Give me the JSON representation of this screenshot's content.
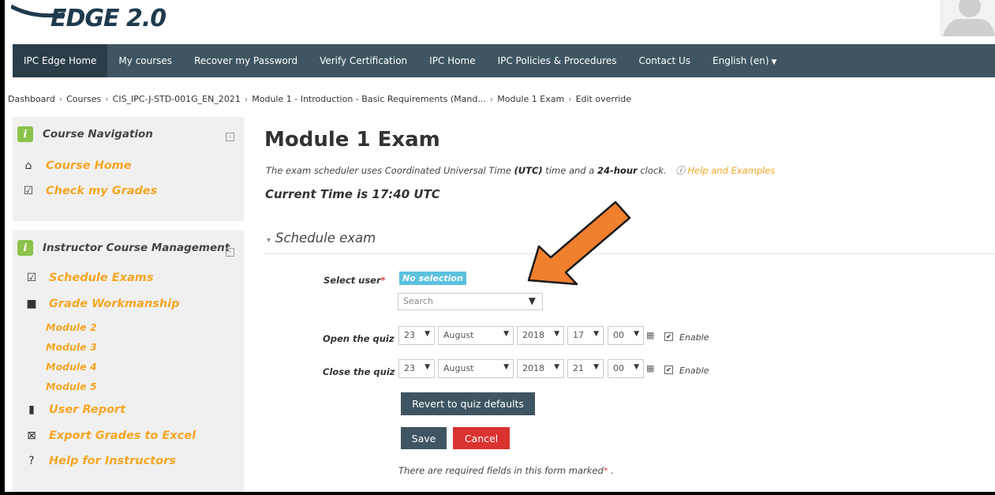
{
  "header": {
    "logo_text": "EDGE 2.0"
  },
  "navbar": {
    "items": [
      {
        "label": "IPC Edge Home"
      },
      {
        "label": "My courses"
      },
      {
        "label": "Recover my Password"
      },
      {
        "label": "Verify Certification"
      },
      {
        "label": "IPC Home"
      },
      {
        "label": "IPC Policies & Procedures"
      },
      {
        "label": "Contact Us"
      },
      {
        "label": "English (en)"
      }
    ]
  },
  "breadcrumb": [
    "Dashboard",
    "Courses",
    "CIS_IPC-J-STD-001G_EN_2021",
    "Module 1 - Introduction - Basic Requirements (Mand...",
    "Module 1 Exam",
    "Edit override"
  ],
  "sidebar": {
    "course_nav": {
      "title": "Course Navigation",
      "items": [
        {
          "label": "Course Home",
          "icon": "home-icon"
        },
        {
          "label": "Check my Grades",
          "icon": "checkbox-icon"
        }
      ]
    },
    "instructor": {
      "title": "Instructor Course Management",
      "items": [
        {
          "label": "Schedule Exams",
          "icon": "calendar-check-icon"
        },
        {
          "label": "Grade Workmanship",
          "icon": "chip-icon"
        },
        {
          "label": "User Report",
          "icon": "file-icon"
        },
        {
          "label": "Export Grades to Excel",
          "icon": "excel-icon"
        },
        {
          "label": "Help for Instructors",
          "icon": "help-icon"
        }
      ],
      "modules": [
        "Module 2",
        "Module 3",
        "Module 4",
        "Module 5"
      ]
    }
  },
  "main": {
    "title": "Module 1 Exam",
    "note_pre": "The exam scheduler uses Coordinated Universal Time ",
    "note_utc": "(UTC)",
    "note_mid": " time and a ",
    "note_24": "24-hour",
    "note_post": " clock.",
    "help_link": "Help and Examples",
    "current_time": "Current Time is 17:40 UTC",
    "section_title": "Schedule exam",
    "select_user_label": "Select user",
    "no_selection": "No selection",
    "search_placeholder": "Search",
    "open_label": "Open the quiz",
    "close_label": "Close the quiz",
    "open": {
      "day": "23",
      "month": "August",
      "year": "2018",
      "hour": "17",
      "minute": "00",
      "enable": "Enable"
    },
    "close": {
      "day": "23",
      "month": "August",
      "year": "2018",
      "hour": "21",
      "minute": "00",
      "enable": "Enable"
    },
    "revert_button": "Revert to quiz defaults",
    "save_button": "Save",
    "cancel_button": "Cancel",
    "required_note": "There are required fields in this form marked",
    "required_mark": "*",
    "required_end": " ."
  },
  "colors": {
    "navbar": "#3f5561",
    "accent_link": "#f5a623",
    "badge": "#5bc0de",
    "cancel": "#d9322f",
    "arrow": "#f07f2e"
  }
}
